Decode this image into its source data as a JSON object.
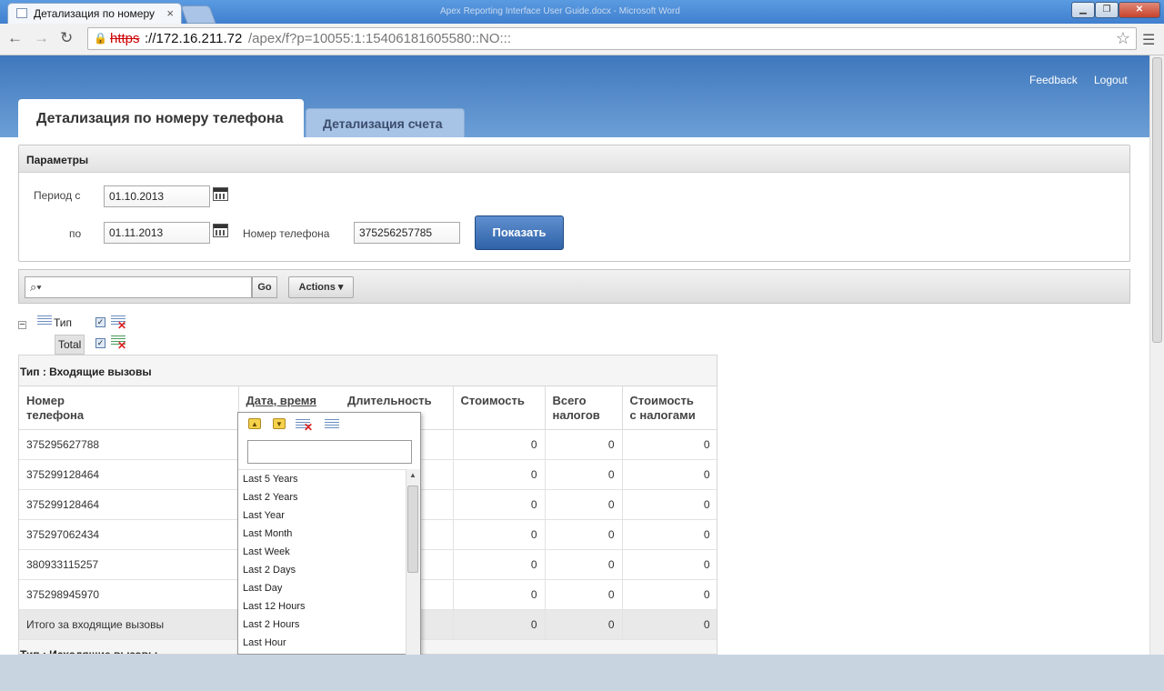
{
  "browser": {
    "tab_title": "Детализация по номеру ",
    "tab_close": "×",
    "background_window_title": "Apex Reporting Interface User Guide.docx - Microsoft Word",
    "url_scheme": "https",
    "url_host": "://172.16.211.72",
    "url_path": "/apex/f?p=10055:1:15406181605580::NO:::",
    "icons": [
      "back-icon",
      "forward-icon",
      "reload-icon",
      "bookmark-star-icon",
      "chrome-menu-icon"
    ]
  },
  "header": {
    "links": [
      "Feedback",
      "Logout"
    ],
    "tabs": [
      {
        "label": "Детализация по номеру телефона",
        "active": true
      },
      {
        "label": "Детализация счета",
        "active": false
      }
    ]
  },
  "parameters": {
    "title": "Параметры",
    "period_from_label": "Период с",
    "period_from_value": "01.10.2013",
    "period_to_label": "по",
    "period_to_value": "01.11.2013",
    "phone_label": "Номер телефона",
    "phone_value": "375256257785",
    "show_button": "Показать"
  },
  "ir_toolbar": {
    "search_value": "",
    "go_label": "Go",
    "actions_label": "Actions ▾"
  },
  "controls": {
    "break_label": "Тип",
    "aggregate_label": "Total",
    "collapse": "−"
  },
  "report": {
    "group_label": "Тип : Входящие вызовы",
    "next_group_label": "Тип : Исходящие вызовы",
    "columns": [
      "Номер\nтелефона",
      "Дата, время",
      "Длительность",
      "Стоимость",
      "Всего\nналогов",
      "Стоимость\nс налогами"
    ],
    "rows": [
      {
        "phone": "375295627788",
        "cost": "0",
        "tax": "0",
        "total": "0"
      },
      {
        "phone": "375299128464",
        "cost": "0",
        "tax": "0",
        "total": "0"
      },
      {
        "phone": "375299128464",
        "cost": "0",
        "tax": "0",
        "total": "0"
      },
      {
        "phone": "375297062434",
        "cost": "0",
        "tax": "0",
        "total": "0"
      },
      {
        "phone": "380933115257",
        "cost": "0",
        "tax": "0",
        "total": "0"
      },
      {
        "phone": "375298945970",
        "cost": "0",
        "tax": "0",
        "total": "0"
      }
    ],
    "summary": {
      "label": "Итого за входящие вызовы",
      "cost": "0",
      "tax": "0",
      "total": "0"
    }
  },
  "column_popup": {
    "filter_value": "",
    "items": [
      "Last 5 Years",
      "Last 2 Years",
      "Last Year",
      "Last Month",
      "Last Week",
      "Last 2 Days",
      "Last Day",
      "Last 12 Hours",
      "Last 2 Hours",
      "Last Hour"
    ]
  }
}
